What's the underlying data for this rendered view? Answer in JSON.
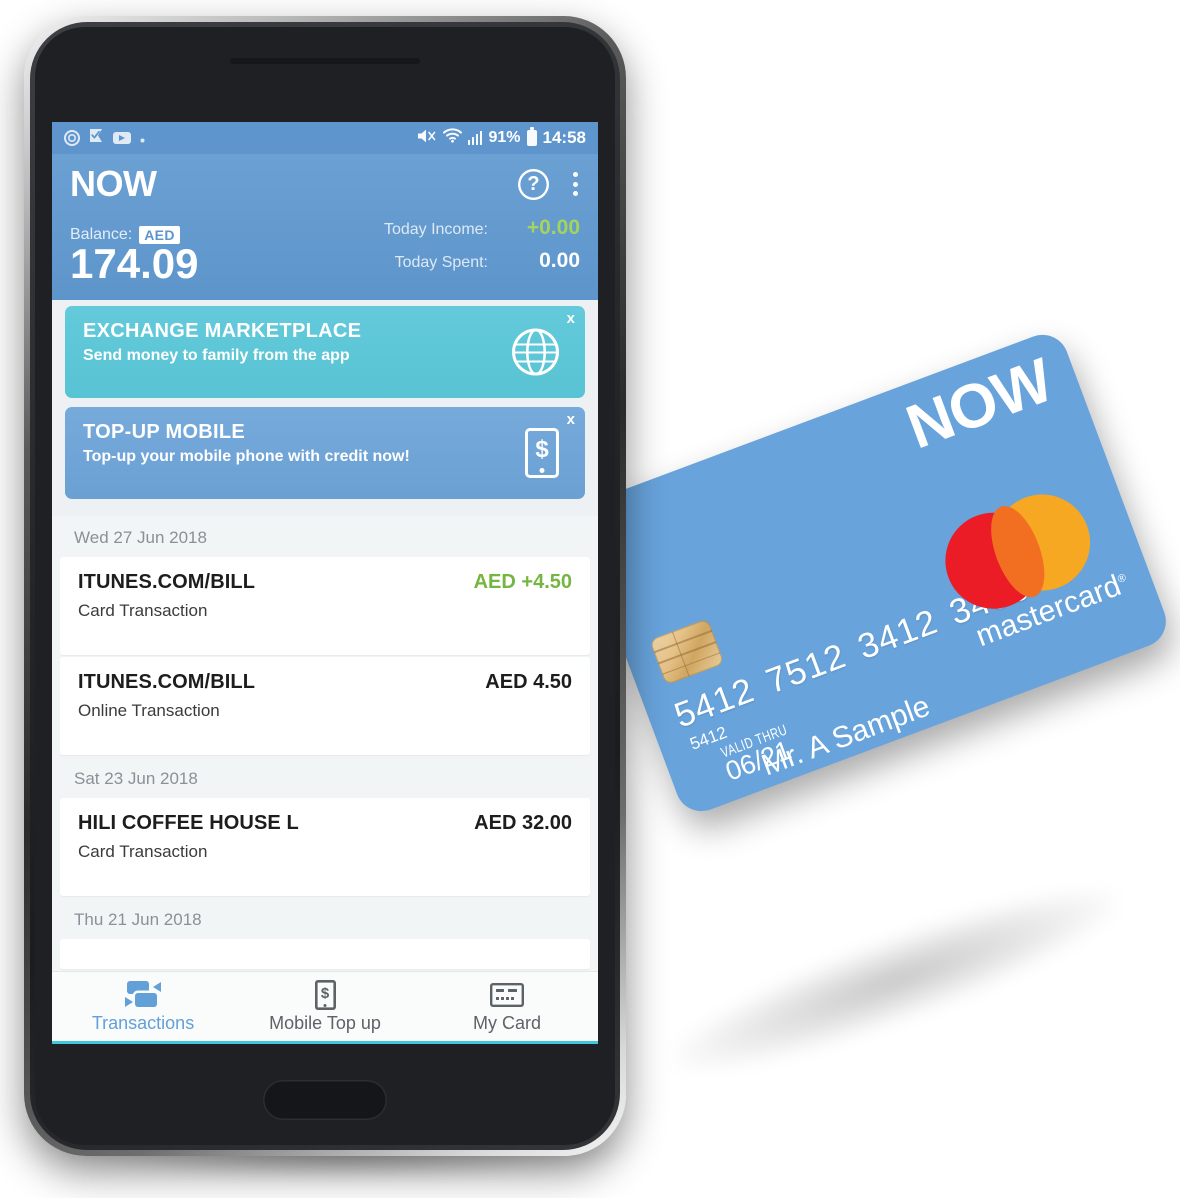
{
  "colors": {
    "brand_blue": "#5d95cb",
    "card_blue": "#68a3dc",
    "promo_teal": "#58c3d4",
    "promo_blue": "#6ba0d3",
    "credit_green": "#74b63f",
    "accent_cyan": "#41c8dd",
    "mastercard_red": "#eb1c26",
    "mastercard_yellow": "#f7a823"
  },
  "phone": {
    "status_bar": {
      "left_icons": [
        "settings-gear-icon",
        "check-flag-icon",
        "video-play-icon",
        "dot-icon"
      ],
      "mute_icon": "mute-icon",
      "wifi_icon": "wifi-icon",
      "signal_icon": "signal-bars-icon",
      "battery_percent": "91%",
      "battery_icon": "battery-icon",
      "time": "14:58"
    },
    "app_bar": {
      "brand": "NOW",
      "help_icon_label": "?",
      "overflow_icon": "kebab-menu-icon"
    },
    "balance": {
      "label": "Balance:",
      "currency": "AED",
      "amount": "174.09",
      "today_income_label": "Today Income:",
      "today_income_value": "+0.00",
      "today_spent_label": "Today Spent:",
      "today_spent_value": "0.00"
    },
    "promos": [
      {
        "title": "EXCHANGE MARKETPLACE",
        "subtitle": "Send money to family from the app",
        "close_label": "x",
        "icon": "globe-icon"
      },
      {
        "title": "TOP-UP MOBILE",
        "subtitle": "Top-up your mobile phone with credit now!",
        "close_label": "x",
        "icon": "phone-dollar-icon"
      }
    ],
    "transaction_groups": [
      {
        "date": "Wed 27 Jun 2018",
        "items": [
          {
            "merchant": "ITUNES.COM/BILL",
            "type": "Card Transaction",
            "currency": "AED",
            "amount": "+4.50",
            "amount_display": "AED +4.50",
            "is_credit": true
          },
          {
            "merchant": "ITUNES.COM/BILL",
            "type": "Online Transaction",
            "currency": "AED",
            "amount": "4.50",
            "amount_display": "AED  4.50",
            "is_credit": false
          }
        ]
      },
      {
        "date": "Sat 23 Jun 2018",
        "items": [
          {
            "merchant": "HILI COFFEE HOUSE L",
            "type": "Card Transaction",
            "currency": "AED",
            "amount": "32.00",
            "amount_display": "AED 32.00",
            "is_credit": false
          }
        ]
      },
      {
        "date": "Thu 21 Jun 2018",
        "items": []
      }
    ],
    "bottom_nav": [
      {
        "label": "Transactions",
        "icon": "transactions-icon",
        "active": true
      },
      {
        "label": "Mobile Top up",
        "icon": "mobile-topup-icon",
        "active": false
      },
      {
        "label": "My Card",
        "icon": "my-card-icon",
        "active": false
      }
    ]
  },
  "credit_card": {
    "brand": "NOW",
    "number_groups": [
      "5412",
      "7512",
      "3412",
      "3456"
    ],
    "number_full": "5412 7512 3412 3456",
    "last_four": "5412",
    "valid_thru_label": "VALID THRU",
    "valid_thru": "06/21",
    "holder_name": "Mr. A Sample",
    "network": "mastercard",
    "network_mark": "®",
    "chip_icon": "emv-chip-icon"
  }
}
